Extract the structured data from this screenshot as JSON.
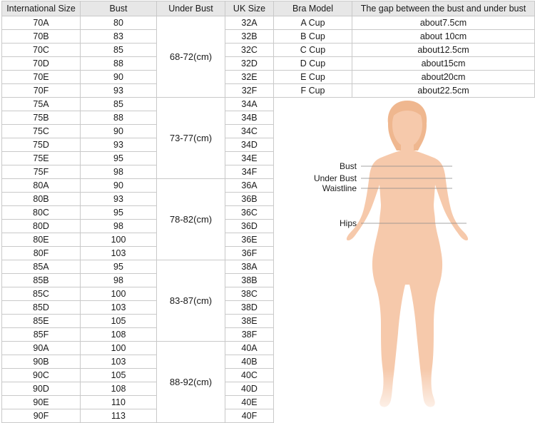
{
  "header": {
    "international_size": "International Size",
    "bust": "Bust",
    "under_bust": "Under Bust",
    "uk_size": "UK Size",
    "bra_model": "Bra Model",
    "gap": "The gap between the bust and under bust"
  },
  "rows": [
    {
      "intl": "70A",
      "bust": "80",
      "uk": "32A"
    },
    {
      "intl": "70B",
      "bust": "83",
      "uk": "32B"
    },
    {
      "intl": "70C",
      "bust": "85",
      "uk": "32C"
    },
    {
      "intl": "70D",
      "bust": "88",
      "uk": "32D"
    },
    {
      "intl": "70E",
      "bust": "90",
      "uk": "32E"
    },
    {
      "intl": "70F",
      "bust": "93",
      "uk": "32F"
    },
    {
      "intl": "75A",
      "bust": "85",
      "uk": "34A"
    },
    {
      "intl": "75B",
      "bust": "88",
      "uk": "34B"
    },
    {
      "intl": "75C",
      "bust": "90",
      "uk": "34C"
    },
    {
      "intl": "75D",
      "bust": "93",
      "uk": "34D"
    },
    {
      "intl": "75E",
      "bust": "95",
      "uk": "34E"
    },
    {
      "intl": "75F",
      "bust": "98",
      "uk": "34F"
    },
    {
      "intl": "80A",
      "bust": "90",
      "uk": "36A"
    },
    {
      "intl": "80B",
      "bust": "93",
      "uk": "36B"
    },
    {
      "intl": "80C",
      "bust": "95",
      "uk": "36C"
    },
    {
      "intl": "80D",
      "bust": "98",
      "uk": "36D"
    },
    {
      "intl": "80E",
      "bust": "100",
      "uk": "36E"
    },
    {
      "intl": "80F",
      "bust": "103",
      "uk": "36F"
    },
    {
      "intl": "85A",
      "bust": "95",
      "uk": "38A"
    },
    {
      "intl": "85B",
      "bust": "98",
      "uk": "38B"
    },
    {
      "intl": "85C",
      "bust": "100",
      "uk": "38C"
    },
    {
      "intl": "85D",
      "bust": "103",
      "uk": "38D"
    },
    {
      "intl": "85E",
      "bust": "105",
      "uk": "38E"
    },
    {
      "intl": "85F",
      "bust": "108",
      "uk": "38F"
    },
    {
      "intl": "90A",
      "bust": "100",
      "uk": "40A"
    },
    {
      "intl": "90B",
      "bust": "103",
      "uk": "40B"
    },
    {
      "intl": "90C",
      "bust": "105",
      "uk": "40C"
    },
    {
      "intl": "90D",
      "bust": "108",
      "uk": "40D"
    },
    {
      "intl": "90E",
      "bust": "110",
      "uk": "40E"
    },
    {
      "intl": "90F",
      "bust": "113",
      "uk": "40F"
    }
  ],
  "under_bust_groups": [
    "68-72(cm)",
    "73-77(cm)",
    "78-82(cm)",
    "83-87(cm)",
    "88-92(cm)"
  ],
  "cups": [
    {
      "model": "A Cup",
      "gap": "about7.5cm"
    },
    {
      "model": "B Cup",
      "gap": "about 10cm"
    },
    {
      "model": "C Cup",
      "gap": "about12.5cm"
    },
    {
      "model": "D Cup",
      "gap": "about15cm"
    },
    {
      "model": "E Cup",
      "gap": "about20cm"
    },
    {
      "model": "F Cup",
      "gap": "about22.5cm"
    }
  ],
  "figure": {
    "bust": "Bust",
    "under_bust": "Under Bust",
    "waistline": "Waistline",
    "hips": "Hips"
  },
  "colors": {
    "header_bg": "#e7e7e7",
    "border": "#c9c9c9",
    "skin": "#f6c9ab",
    "hair": "#efb78f"
  }
}
